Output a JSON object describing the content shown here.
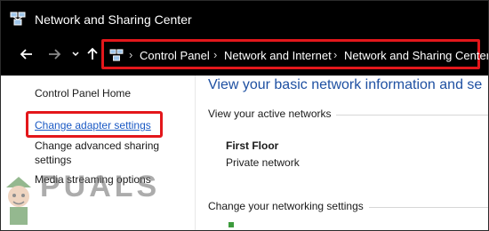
{
  "window": {
    "title": "Network and Sharing Center"
  },
  "nav": {
    "back_icon": "arrow-left-icon",
    "forward_icon": "arrow-right-icon",
    "recent_icon": "chevron-down-icon",
    "up_icon": "arrow-up-icon"
  },
  "address_bar": {
    "crumbs": [
      "Control Panel",
      "Network and Internet",
      "Network and Sharing Center"
    ]
  },
  "sidebar": {
    "home": "Control Panel Home",
    "adapter": "Change adapter settings",
    "advanced_1": "Change advanced sharing",
    "advanced_2": "settings",
    "media": "Media streaming options"
  },
  "main": {
    "heading": "View your basic network information and se",
    "active_label": "View your active networks",
    "network_name": "First Floor",
    "network_type": "Private network",
    "change_label": "Change your networking settings"
  },
  "watermark": {
    "text": "PUALS"
  },
  "colors": {
    "highlight": "#e3171b",
    "link": "#1a59c4",
    "heading": "#1e50a2",
    "titlebar": "#000000"
  }
}
